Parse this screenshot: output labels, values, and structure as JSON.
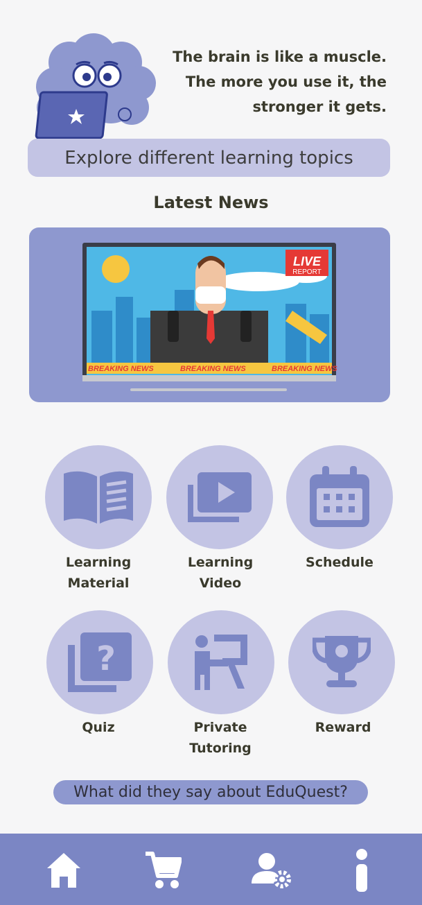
{
  "header": {
    "quote_lines": [
      "The brain is like a muscle.",
      "The more you use it, the",
      "stronger it gets."
    ]
  },
  "explore_button": {
    "label": "Explore different learning topics"
  },
  "news": {
    "title": "Latest News",
    "live_badge_top": "LIVE",
    "live_badge_bottom": "REPORT",
    "ticker_text": "BREAKING NEWS"
  },
  "features": [
    {
      "label_lines": [
        "Learning",
        "Material"
      ],
      "icon": "book-icon"
    },
    {
      "label_lines": [
        "Learning",
        "Video"
      ],
      "icon": "video-library-icon"
    },
    {
      "label_lines": [
        "Schedule"
      ],
      "icon": "calendar-icon"
    },
    {
      "label_lines": [
        "Quiz"
      ],
      "icon": "quiz-icon"
    },
    {
      "label_lines": [
        "Private",
        "Tutoring"
      ],
      "icon": "tutor-icon"
    },
    {
      "label_lines": [
        "Reward"
      ],
      "icon": "trophy-icon"
    }
  ],
  "testimonial_button": {
    "label": "What did they say about EduQuest?"
  },
  "bottom_nav": [
    {
      "icon": "home-icon"
    },
    {
      "icon": "cart-icon"
    },
    {
      "icon": "user-settings-icon"
    },
    {
      "icon": "info-icon"
    }
  ],
  "colors": {
    "background": "#f6f6f7",
    "accent": "#8e98cf",
    "light_accent": "#c3c4e4",
    "icon": "#7b86c4"
  }
}
